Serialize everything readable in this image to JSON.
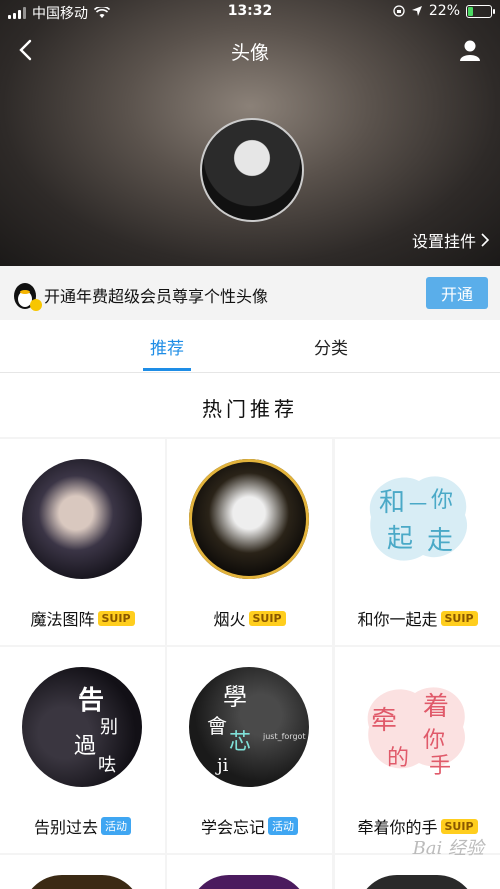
{
  "status_bar": {
    "carrier": "中国移动",
    "time": "13:32",
    "battery_percent": "22%"
  },
  "header": {
    "title": "头像",
    "pendant_label": "设置挂件"
  },
  "vip_banner": {
    "text": "开通年费超级会员尊享个性头像",
    "button": "开通"
  },
  "tabs": [
    {
      "label": "推荐",
      "active": true
    },
    {
      "label": "分类",
      "active": false
    }
  ],
  "section_title": "热门推荐",
  "cards": [
    {
      "label": "魔法图阵",
      "badge": "SUIP",
      "badge_type": "suip"
    },
    {
      "label": "烟火",
      "badge": "SUIP",
      "badge_type": "suip"
    },
    {
      "label": "和你一起走",
      "badge": "SUIP",
      "badge_type": "suip"
    },
    {
      "label": "告别过去",
      "badge": "活动",
      "badge_type": "act"
    },
    {
      "label": "学会忘记",
      "badge": "活动",
      "badge_type": "act"
    },
    {
      "label": "牵着你的手",
      "badge": "SUIP",
      "badge_type": "suip"
    }
  ],
  "art_text": {
    "card3": [
      "和",
      "你",
      "一",
      "起",
      "走"
    ],
    "card4": [
      "告",
      "别",
      "過",
      "呿"
    ],
    "card5": [
      "學",
      "會",
      "芯",
      "ji",
      "just_forgot"
    ],
    "card6": [
      "牵",
      "着",
      "你",
      "的",
      "手"
    ]
  },
  "watermark": "Bai 经验",
  "colors": {
    "accent_blue": "#1e8de6",
    "button_blue": "#5aaeea",
    "suip_yellow": "#ffce1e",
    "activity_blue": "#3fa6f2"
  }
}
